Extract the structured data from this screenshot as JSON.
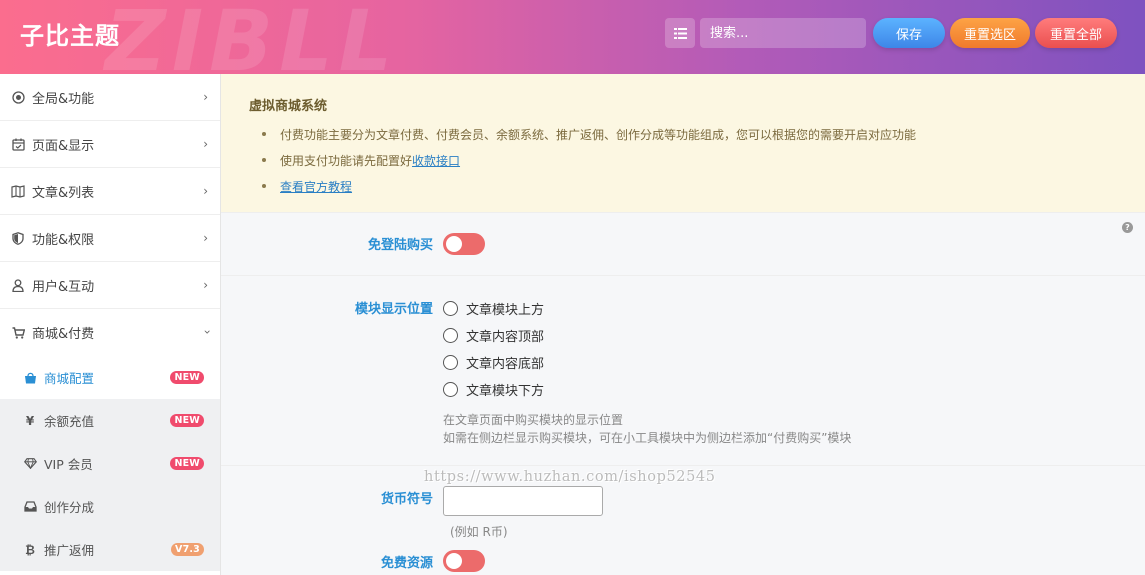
{
  "header": {
    "logo": "子比主题",
    "watermark": "ZIBLL",
    "search_placeholder": "搜索...",
    "save": "保存",
    "reset_section": "重置选区",
    "reset_all": "重置全部"
  },
  "sidebar": {
    "items": [
      {
        "label": "全局&功能",
        "icon": "target-icon"
      },
      {
        "label": "页面&显示",
        "icon": "calendar-check-icon"
      },
      {
        "label": "文章&列表",
        "icon": "map-icon"
      },
      {
        "label": "功能&权限",
        "icon": "shield-icon"
      },
      {
        "label": "用户&互动",
        "icon": "user-icon"
      },
      {
        "label": "商城&付费",
        "icon": "cart-icon"
      }
    ],
    "sub_items": [
      {
        "label": "商城配置",
        "badge": "NEW",
        "icon": "shopping-bag-icon"
      },
      {
        "label": "余额充值",
        "badge": "NEW",
        "icon": "yen-icon"
      },
      {
        "label": "VIP 会员",
        "badge": "NEW",
        "icon": "diamond-icon"
      },
      {
        "label": "创作分成",
        "badge": "",
        "icon": "inbox-icon"
      },
      {
        "label": "推广返佣",
        "badge": "V7.3",
        "icon": "bitcoin-icon"
      }
    ]
  },
  "notice": {
    "title": "虚拟商城系统",
    "line1": "付费功能主要分为文章付费、付费会员、余额系统、推广返佣、创作分成等功能组成，您可以根据您的需要开启对应功能",
    "line2_prefix": "使用支付功能请先配置好",
    "line2_link": "收款接口",
    "line3_link": "查看官方教程"
  },
  "settings": {
    "guest_buy_label": "免登陆购买",
    "guest_buy_enabled": false,
    "position_label": "模块显示位置",
    "position_options": [
      "文章模块上方",
      "文章内容顶部",
      "文章内容底部",
      "文章模块下方"
    ],
    "position_desc1": "在文章页面中购买模块的显示位置",
    "position_desc2": "如需在侧边栏显示购买模块，可在小工具模块中为侧边栏添加“付费购买”模块",
    "currency_label": "货币符号",
    "currency_value": "",
    "currency_hint": "(例如 R币)",
    "free_resource_label": "免费资源",
    "free_resource_enabled": false
  },
  "overlay_watermark": "https://www.huzhan.com/ishop52545",
  "colors": {
    "accent": "#2a8fd4",
    "toggle_off": "#ec6b6b",
    "badge_new": "#f04b6d"
  }
}
